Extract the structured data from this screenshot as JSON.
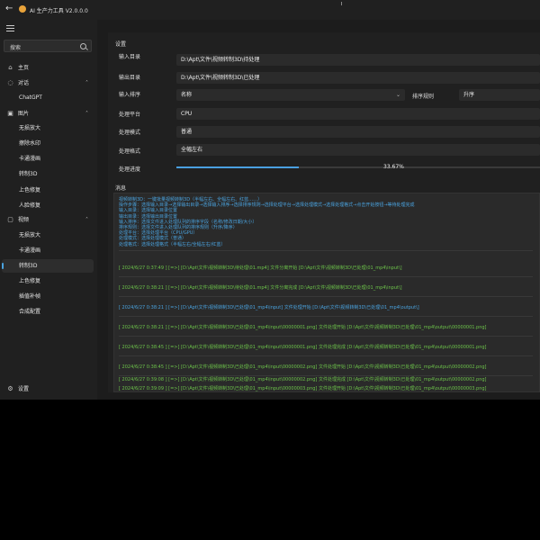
{
  "app": {
    "title": "AI 生产力工具 V2.0.0.0"
  },
  "sidebar": {
    "search_placeholder": "搜索",
    "items": [
      {
        "label": "主页",
        "icon": "home-icon"
      },
      {
        "label": "对话",
        "icon": "chat-icon"
      },
      {
        "label": "ChatGPT"
      },
      {
        "label": "图片",
        "icon": "image-icon"
      },
      {
        "label": "无损放大"
      },
      {
        "label": "擦除水印"
      },
      {
        "label": "卡通漫画"
      },
      {
        "label": "转制3D"
      },
      {
        "label": "上色修复"
      },
      {
        "label": "人脸修复"
      },
      {
        "label": "视频",
        "icon": "video-icon"
      },
      {
        "label": "无损放大"
      },
      {
        "label": "卡通漫画"
      },
      {
        "label": "转制3D"
      },
      {
        "label": "上色修复"
      },
      {
        "label": "插值补帧"
      },
      {
        "label": "合成配置"
      }
    ],
    "settings_label": "设置"
  },
  "settings": {
    "section_title": "设置",
    "input_dir_label": "输入目录",
    "input_dir_value": "D:\\Apt\\文件\\视频转制3D\\待处理",
    "output_dir_label": "输出目录",
    "output_dir_value": "D:\\Apt\\文件\\视频转制3D\\已处理",
    "sort_label": "输入排序",
    "sort_value": "名称",
    "sort_rule_label": "排序规则",
    "sort_rule_value": "升序",
    "platform_label": "处理平台",
    "platform_value": "CPU",
    "mode_label": "处理模式",
    "mode_value": "普通",
    "format_label": "处理格式",
    "format_value": "全幅左右",
    "progress_label": "处理进度",
    "progress_value": 0.3367,
    "progress_text": "33.67%"
  },
  "messages": {
    "title": "消息",
    "help_lines": [
      "视频转制3D：一键批量视频转制3D（半幅左右、全幅左右、红蓝……）",
      "操作步骤：选择输入目录→选择输出目录→选择输入排序→选择排序规则→选择处理平台→选择处理模式→选择处理格式→点击开始按钮→等待处理完成",
      "输入目录：选择输入目录位置",
      "输出目录：选择输出目录位置",
      "输入排序：选择文件进入处理队列的排序字段（名称/修改日期/大小）",
      "排序规则：选择文件进入处理队列的排序规则（升序/降序）",
      "处理平台：选择处理平台（CPU/GPU）",
      "处理模式：选择处理模式（普通）",
      "处理格式：选择处理格式（半幅左右/全幅左右/红蓝）"
    ],
    "logs": [
      {
        "text": "[ 2024/6/27 0:37:49 ] [=>] [D:\\Apt\\文件\\视频转制3D\\待处理\\01.mp4] 文件分离开始 [D:\\Apt\\文件\\视频转制3D\\已处理\\01_mp4\\input\\]",
        "color": "green"
      },
      {
        "text": "[ 2024/6/27 0:38:21 ] [=>] [D:\\Apt\\文件\\视频转制3D\\待处理\\01.mp4] 文件分离完成 [D:\\Apt\\文件\\视频转制3D\\已处理\\01_mp4\\input\\]",
        "color": "green"
      },
      {
        "text": "[ 2024/6/27 0:38:21 ] [=>] [D:\\Apt\\文件\\视频转制3D\\已处理\\01_mp4\\input] 文件处理开始 [D:\\Apt\\文件\\视频转制3D\\已处理\\01_mp4\\output\\]",
        "color": "blue"
      },
      {
        "text": "[ 2024/6/27 0:38:21 ] [=>] [D:\\Apt\\文件\\视频转制3D\\已处理\\01_mp4\\input\\00000001.png] 文件处理开始 [D:\\Apt\\文件\\视频转制3D\\已处理\\01_mp4\\output\\00000001.png]",
        "color": "green"
      },
      {
        "text": "[ 2024/6/27 0:38:45 ] [=>] [D:\\Apt\\文件\\视频转制3D\\已处理\\01_mp4\\input\\00000001.png] 文件处理完成 [D:\\Apt\\文件\\视频转制3D\\已处理\\01_mp4\\output\\00000001.png]",
        "color": "green"
      },
      {
        "text": "[ 2024/6/27 0:38:45 ] [=>] [D:\\Apt\\文件\\视频转制3D\\已处理\\01_mp4\\input\\00000002.png] 文件处理开始 [D:\\Apt\\文件\\视频转制3D\\已处理\\01_mp4\\output\\00000002.png]",
        "color": "green"
      },
      {
        "text": "[ 2024/6/27 0:39:08 ] [=>] [D:\\Apt\\文件\\视频转制3D\\已处理\\01_mp4\\input\\00000002.png] 文件处理完成 [D:\\Apt\\文件\\视频转制3D\\已处理\\01_mp4\\output\\00000002.png]",
        "color": "green"
      },
      {
        "text": "[ 2024/6/27 0:39:09 ] [=>] [D:\\Apt\\文件\\视频转制3D\\已处理\\01_mp4\\input\\00000003.png] 文件处理开始 [D:\\Apt\\文件\\视频转制3D\\已处理\\01_mp4\\output\\00000003.png]",
        "color": "green"
      }
    ]
  },
  "colors": {
    "accent": "#4aa3df",
    "log_green": "#6cc24a",
    "log_blue": "#4aa3df"
  }
}
